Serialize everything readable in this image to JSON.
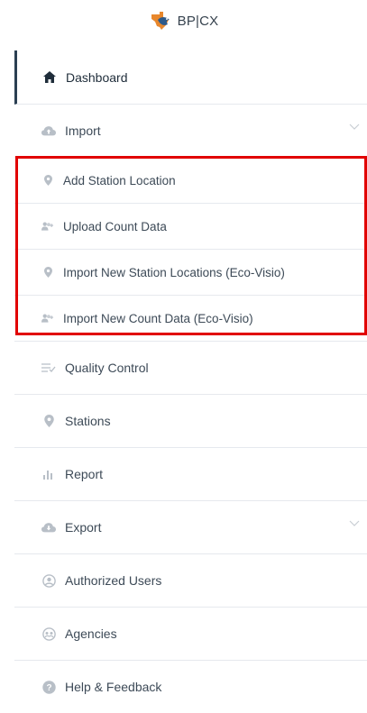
{
  "brand": {
    "name": "BP|CX",
    "logo_icon": "texas-bird-logo-icon"
  },
  "nav": {
    "dashboard": "Dashboard",
    "import": "Import",
    "import_sub": [
      "Add Station Location",
      "Upload Count Data",
      "Import New Station Locations (Eco-Visio)",
      "Import New Count Data (Eco-Visio)"
    ],
    "quality_control": "Quality Control",
    "stations": "Stations",
    "report": "Report",
    "export": "Export",
    "authorized_users": "Authorized Users",
    "agencies": "Agencies",
    "help": "Help & Feedback"
  },
  "colors": {
    "accent": "#2b3f52",
    "icon_gray": "#b8bfc7",
    "highlight": "#e10000",
    "logo_orange": "#e8872c",
    "logo_blue": "#2f5b8a"
  }
}
